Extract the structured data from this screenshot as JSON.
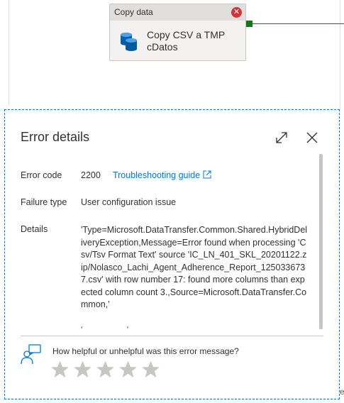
{
  "activity": {
    "type_label": "Copy data",
    "name_line1": "Copy CSV a TMP",
    "name_line2": "cDatos",
    "error_badge": "✕"
  },
  "error_panel": {
    "title": "Error details",
    "error_code_label": "Error code",
    "error_code_value": "2200",
    "troubleshooting_link": "Troubleshooting guide",
    "failure_type_label": "Failure type",
    "failure_type_value": "User configuration issue",
    "details_label": "Details",
    "details_value": "'Type=Microsoft.DataTransfer.Common.Shared.HybridDeliveryException,Message=Error found when processing 'Csv/Tsv Format Text' source 'IC_LN_401_SKL_20201122.zip/Nolasco_Lachi_Agent_Adherence_Report_1250336737.csv' with row number 17: found more columns than expected column count 3.,Source=Microsoft.DataTransfer.Common,'",
    "details_cutoff": "'..................'"
  },
  "feedback": {
    "question": "How helpful or unhelpful was this error message?",
    "stars": 5
  },
  "stray_char": "e",
  "colors": {
    "accent": "#0078d4",
    "error": "#d13438",
    "success": "#107c10"
  }
}
